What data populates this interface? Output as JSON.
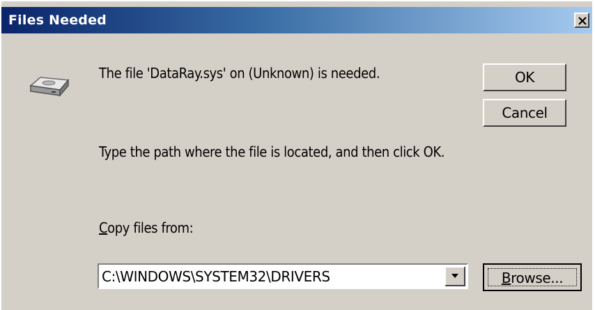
{
  "window": {
    "title": "Files Needed",
    "close_icon": "close-x-icon"
  },
  "content": {
    "icon": "drive-icon",
    "message": "The file 'DataRay.sys' on (Unknown) is needed.",
    "instruction": "Type the path where the file is located, and then click OK.",
    "copy_label_accel": "C",
    "copy_label_rest": "opy files from:"
  },
  "buttons": {
    "ok": "OK",
    "cancel": "Cancel",
    "browse_accel": "B",
    "browse_rest": "rowse..."
  },
  "path_combo": {
    "value": "C:\\WINDOWS\\SYSTEM32\\DRIVERS",
    "arrow_icon": "chevron-down-icon"
  },
  "colors": {
    "dialog_face": "#d4d0c8",
    "title_gradient_start": "#0a246a",
    "title_gradient_end": "#a6caf0"
  }
}
